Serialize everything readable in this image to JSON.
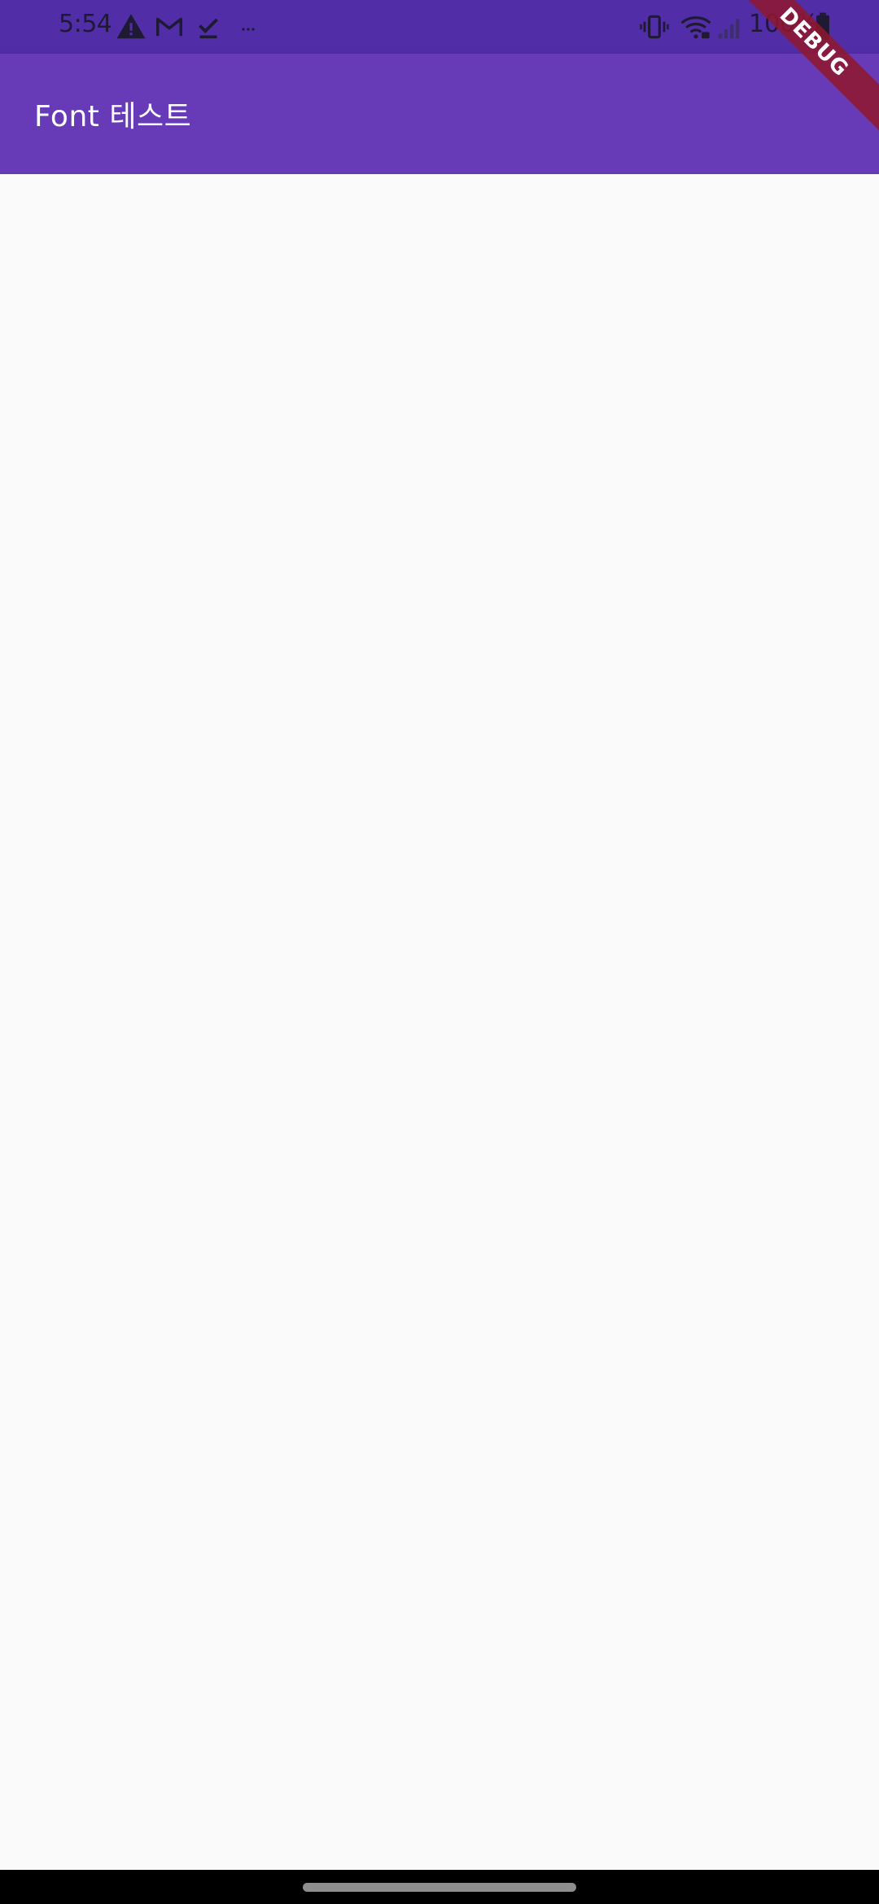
{
  "status_bar": {
    "time": "5:54",
    "battery_text": "100%",
    "left_icons": [
      "warning-icon",
      "gmail-icon",
      "download-done-icon",
      "more-dots-icon"
    ],
    "right_icons": [
      "vibrate-icon",
      "wifi-icon",
      "signal-icon",
      "battery-icon"
    ]
  },
  "app_bar": {
    "title": "Font 테스트"
  },
  "debug_banner": {
    "label": "DEBUG"
  },
  "colors": {
    "status_bar": "#512DA8",
    "app_bar": "#673AB7",
    "background": "#FAFAFA",
    "debug_banner": "#90182E",
    "nav_bar": "#000000"
  }
}
